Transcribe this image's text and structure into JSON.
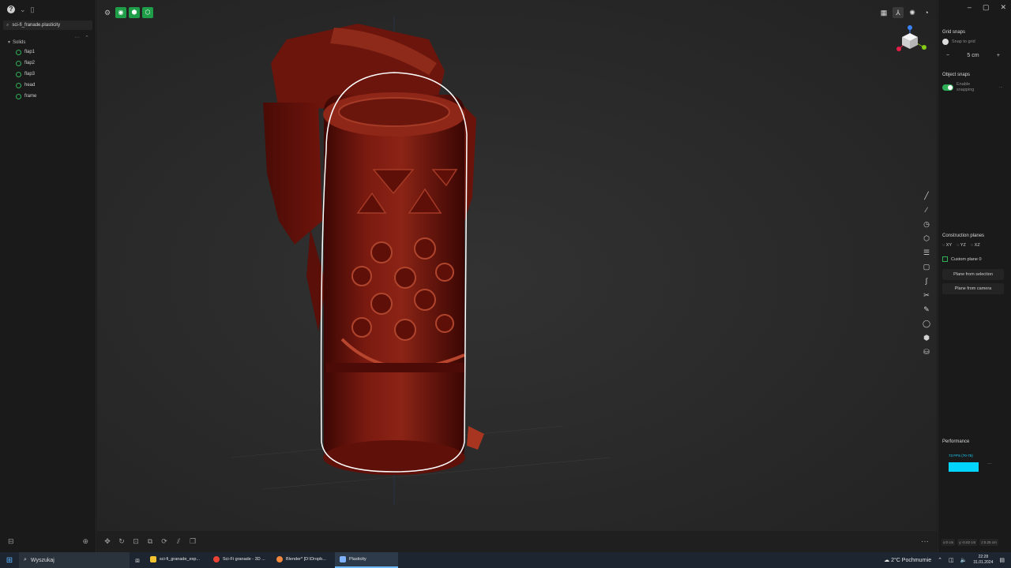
{
  "outliner": {
    "help_glyph": "?",
    "file_tab": "sci-fi_franade.plasticity",
    "tree_header": "Solids",
    "solids": [
      "flap1",
      "flap2",
      "flap3",
      "head",
      "frame"
    ]
  },
  "viewport": {
    "toolbar_icons": [
      "settings-icon",
      "solid-mode-icon",
      "mesh-mode-icon",
      "box-mode-icon"
    ],
    "right_tools": [
      "grid-icon",
      "axis-icon",
      "sun-icon",
      "circle-icon"
    ],
    "side_tools": [
      "line-icon",
      "curve-icon",
      "circle-tool-icon",
      "polygon-icon",
      "cylinder-icon",
      "rectangle-icon",
      "spline-icon",
      "scissors-icon",
      "pen-icon",
      "sphere-icon",
      "cube-icon",
      "can-icon"
    ],
    "bottom_tools": [
      "move-icon",
      "rotate-icon",
      "scale-icon",
      "copy-icon",
      "transform-icon",
      "mirror-icon",
      "duplicate-icon"
    ]
  },
  "right_panel": {
    "grid_snaps_title": "Grid snaps",
    "snap_to_grid": "Snap to grid",
    "grid_value": "5 cm",
    "grid_minus": "−",
    "grid_plus": "+",
    "object_snaps_title": "Object snaps",
    "enable_snapping_1": "Enable",
    "enable_snapping_2": "snapping",
    "object_more": "...",
    "construction_title": "Construction planes",
    "planes": [
      "XY",
      "YZ",
      "XZ"
    ],
    "custom_plane": "Custom plane 0",
    "plane_from_selection": "Plane from selection",
    "plane_from_camera": "Plane from camera",
    "performance_title": "Performance",
    "fps_label": "73 FPS (70-75)",
    "perf_more": "...",
    "coords": [
      "x:0 cm",
      "y:-0.02 cm",
      "z:0.25 cm"
    ]
  },
  "taskbar": {
    "search_placeholder": "Wyszukaj",
    "apps": [
      {
        "label": "sci-fi_granade_exp...",
        "color": "#f4c430",
        "active": false
      },
      {
        "label": "Sci-Fi granade - 3D ...",
        "color": "#e94235",
        "active": false
      },
      {
        "label": "Blender* [D:\\Dropb...",
        "color": "#f0883e",
        "active": false
      },
      {
        "label": "Plasticity",
        "color": "#7fb2ff",
        "active": true
      }
    ],
    "weather": "2°C  Pochmurnie",
    "time": "22:28",
    "date": "31.01.2024"
  }
}
